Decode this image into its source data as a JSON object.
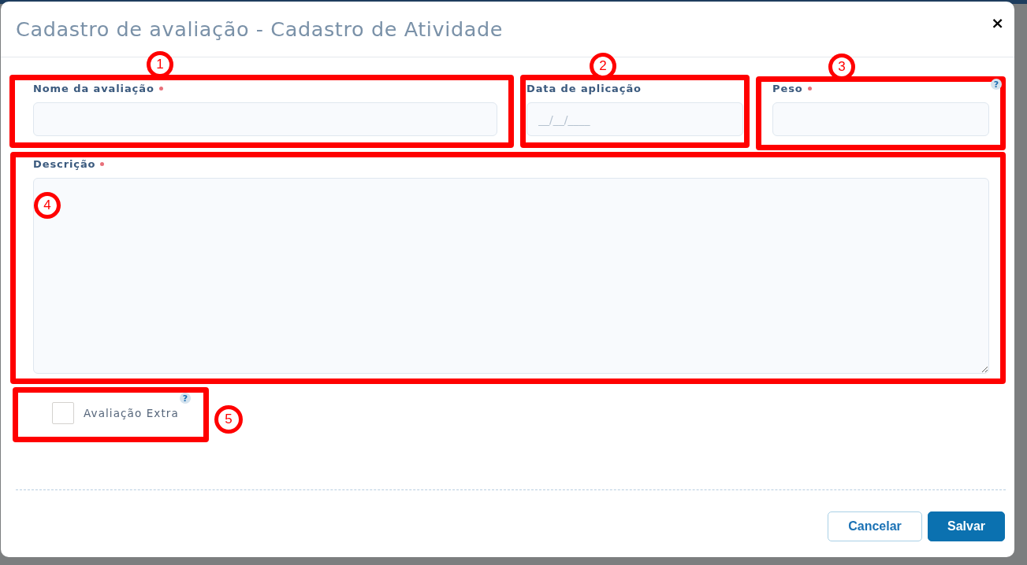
{
  "dialog": {
    "title": "Cadastro de avaliação - Cadastro de Atividade",
    "close": "×"
  },
  "fields": [
    {
      "kind": "input",
      "label": "Nome da avaliação",
      "required": true,
      "annotation": "1"
    },
    {
      "kind": "input",
      "label": "Data de aplicação",
      "required": false,
      "placeholder": "__/__/____",
      "annotation": "2"
    },
    {
      "kind": "input",
      "label": "Peso",
      "required": true,
      "help": "?",
      "annotation": "3"
    },
    {
      "kind": "textarea",
      "label": "Descrição",
      "required": true,
      "annotation": "4"
    },
    {
      "kind": "checkbox",
      "label": "Avaliação Extra",
      "checked": false,
      "help": "?",
      "annotation": "5"
    }
  ],
  "buttons": [
    {
      "label": "Cancelar",
      "kind": "secondary"
    },
    {
      "label": "Salvar",
      "kind": "primary"
    }
  ]
}
